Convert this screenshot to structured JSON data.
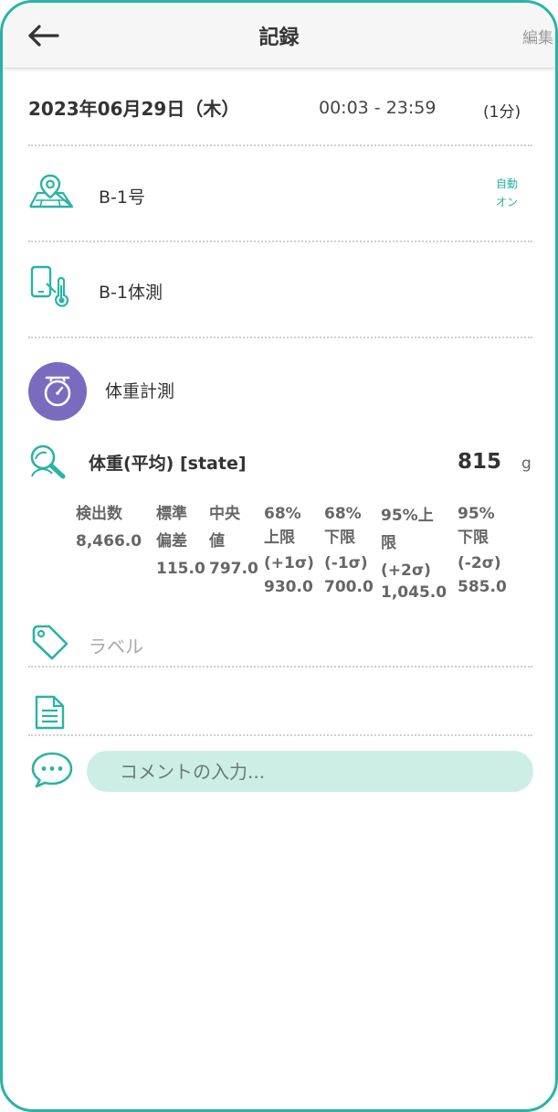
{
  "header": {
    "title": "記録",
    "edit_label": "編集"
  },
  "record": {
    "date": "2023年06月29日（木）",
    "time_range": "00:03 - 23:59",
    "duration": "(1分)"
  },
  "location": {
    "name": "B-1号",
    "auto_line1": "自動",
    "auto_line2": "オン"
  },
  "device": {
    "name": "B-1体測"
  },
  "activity": {
    "name": "体重計測"
  },
  "metric": {
    "name": "体重(平均) [state]",
    "value": "815",
    "unit": "g"
  },
  "stats": {
    "col1": {
      "h1": "検出数",
      "v": "8,466.0"
    },
    "col2": {
      "h1": "標準",
      "h2": "偏差",
      "v": "115.0"
    },
    "col3": {
      "h1": "中央",
      "h2": "値",
      "v": "797.0"
    },
    "col4": {
      "h1": "68%",
      "h2": "上限",
      "h3": "(+1σ)",
      "v": "930.0"
    },
    "col5": {
      "h1": "68%",
      "h2": "下限",
      "h3": "(-1σ)",
      "v": "700.0"
    },
    "col6": {
      "h1": "95%上",
      "h2": "限",
      "h3": "(+2σ)",
      "v": "1,045.0"
    },
    "col7": {
      "h1": "95%",
      "h2": "下限",
      "h3": "(-2σ)",
      "v": "585.0"
    }
  },
  "label": {
    "placeholder": "ラベル"
  },
  "comment": {
    "placeholder": "コメントの入力..."
  },
  "colors": {
    "accent": "#29b3a6",
    "purple": "#7b6bbf",
    "comment_bg": "#cdeee7"
  }
}
